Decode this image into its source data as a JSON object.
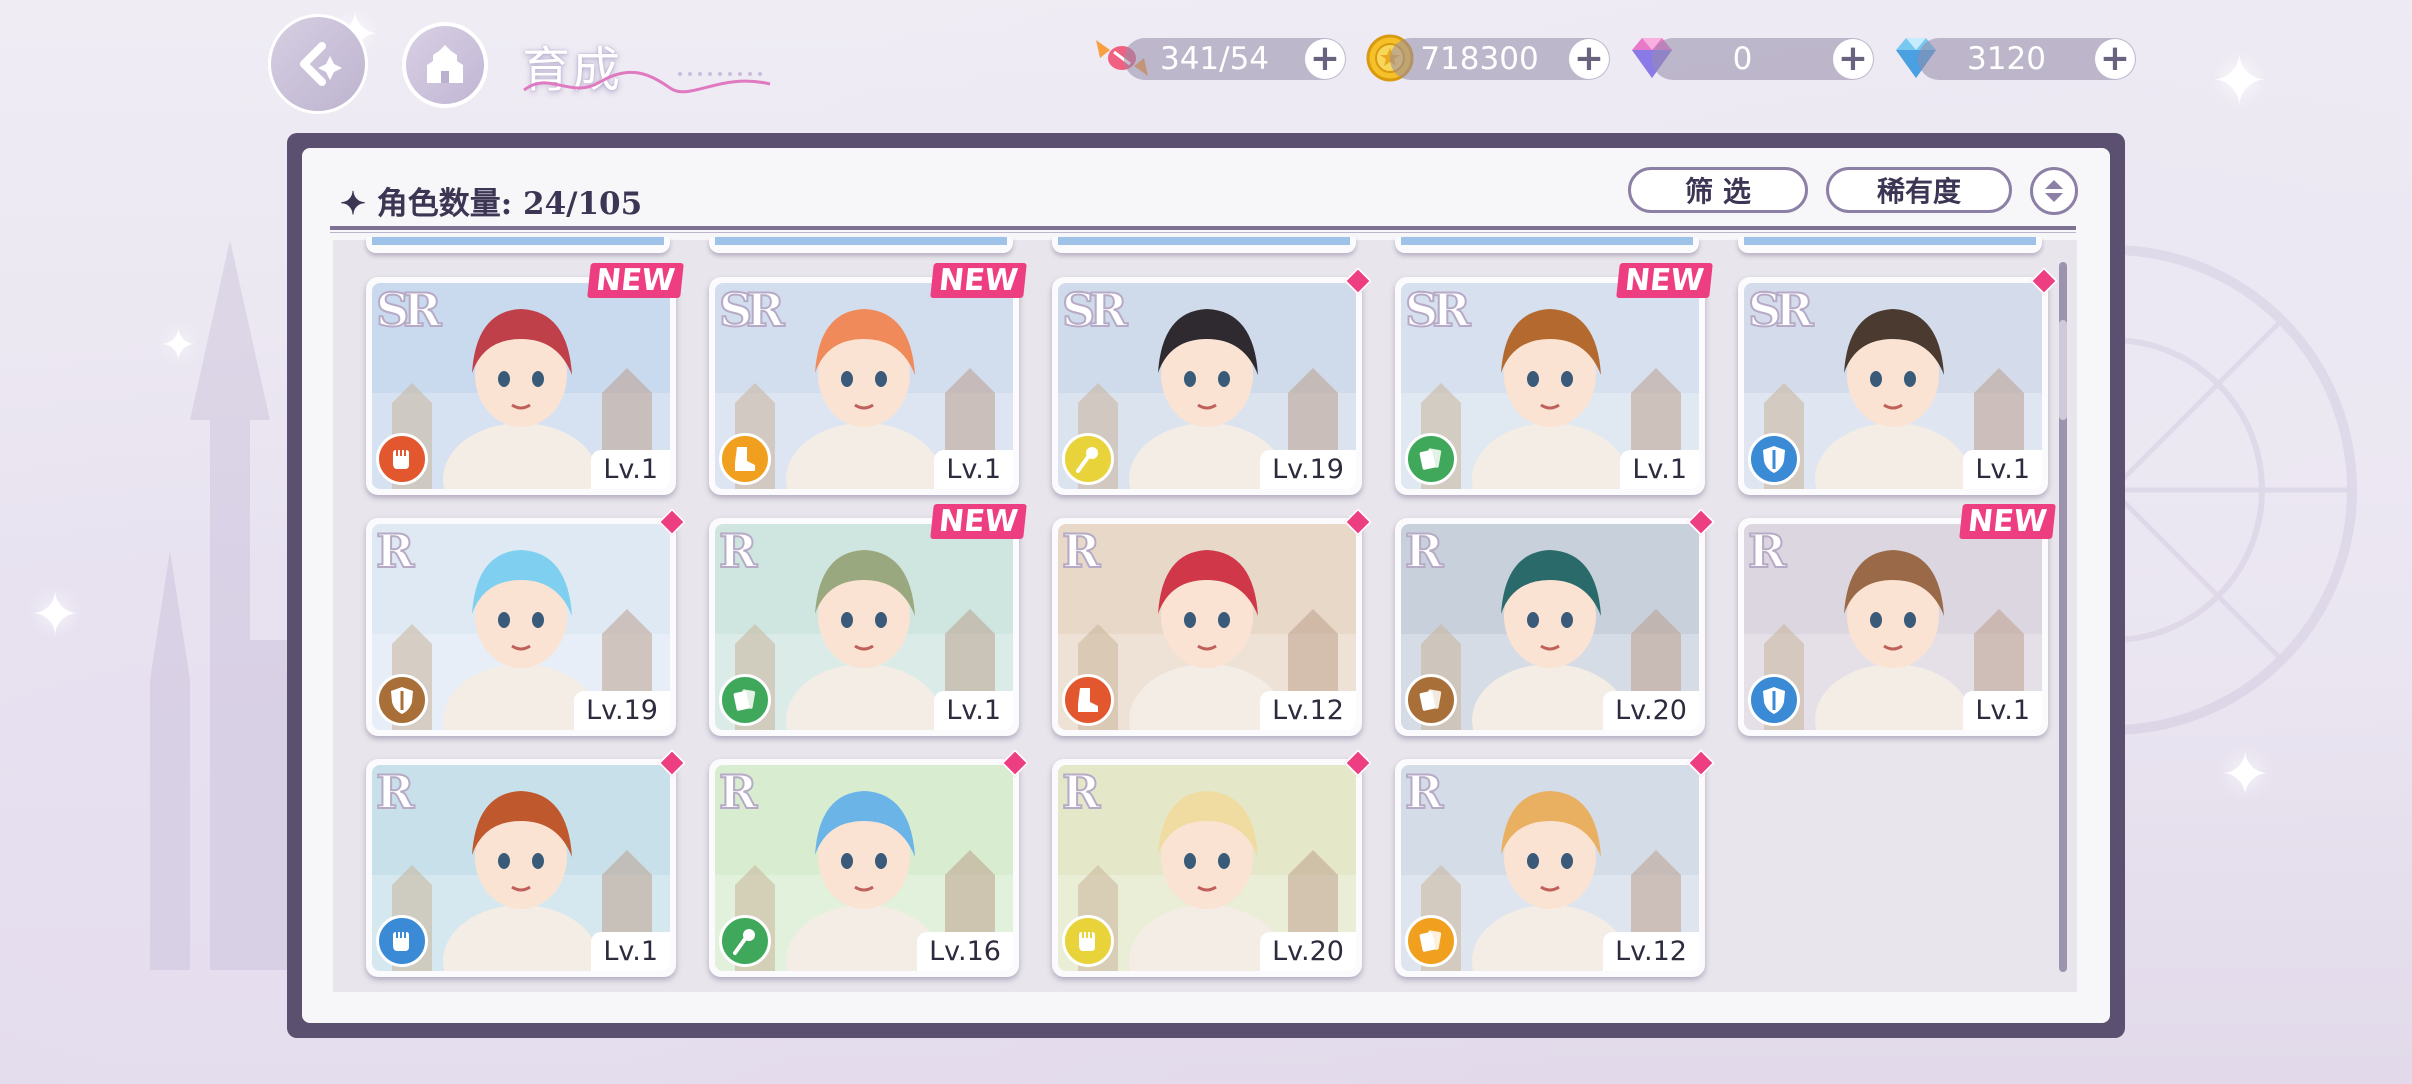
{
  "header": {
    "title": "育成"
  },
  "resources": [
    {
      "name": "candy",
      "value": "341/54"
    },
    {
      "name": "coin",
      "value": "718300"
    },
    {
      "name": "rainbow-gem",
      "value": "0"
    },
    {
      "name": "diamond",
      "value": "3120"
    }
  ],
  "panel": {
    "count_label": "角色数量: 24/105",
    "filter_label": "筛 选",
    "sort_label": "稀有度"
  },
  "colors": {
    "accent_pink": "#ee3e82",
    "panel_frame": "#5b5070",
    "role_red": "#e2572e",
    "role_orange": "#f0a01e",
    "role_yellow": "#e8d43a",
    "role_green": "#3fa85a",
    "role_blue": "#3a8ad6",
    "role_brown": "#a87038"
  },
  "cards": [
    {
      "rarity": "SR",
      "level": "Lv.1",
      "badge": "NEW",
      "role": "fist-icon",
      "role_color": "#e2572e",
      "bg": "#c9d9ee",
      "hair": "#c0404a"
    },
    {
      "rarity": "SR",
      "level": "Lv.1",
      "badge": "NEW",
      "role": "boot-icon",
      "role_color": "#f0a01e",
      "bg": "#d2ddee",
      "hair": "#f08a5a"
    },
    {
      "rarity": "SR",
      "level": "Lv.19",
      "badge": "diamond",
      "role": "staff-icon",
      "role_color": "#e8d43a",
      "bg": "#cfdaea",
      "hair": "#2e2a30"
    },
    {
      "rarity": "SR",
      "level": "Lv.1",
      "badge": "NEW",
      "role": "cards-icon",
      "role_color": "#3fa85a",
      "bg": "#d6e0ee",
      "hair": "#b46a2e"
    },
    {
      "rarity": "SR",
      "level": "Lv.1",
      "badge": "diamond",
      "role": "shield-icon",
      "role_color": "#3a8ad6",
      "bg": "#d4dcec",
      "hair": "#4a3a30"
    },
    {
      "rarity": "R",
      "level": "Lv.19",
      "badge": "diamond",
      "role": "shield-icon",
      "role_color": "#a87038",
      "bg": "#dfe9f4",
      "hair": "#7fd0f0"
    },
    {
      "rarity": "R",
      "level": "Lv.1",
      "badge": "NEW",
      "role": "cards-icon",
      "role_color": "#3fa85a",
      "bg": "#cfe6e0",
      "hair": "#9aa880"
    },
    {
      "rarity": "R",
      "level": "Lv.12",
      "badge": "diamond",
      "role": "boot-icon",
      "role_color": "#e2572e",
      "bg": "#e8d8c8",
      "hair": "#d0384a"
    },
    {
      "rarity": "R",
      "level": "Lv.20",
      "badge": "diamond",
      "role": "cards-icon",
      "role_color": "#a87038",
      "bg": "#c8d0dc",
      "hair": "#2a6a6a"
    },
    {
      "rarity": "R",
      "level": "Lv.1",
      "badge": "NEW",
      "role": "shield-icon",
      "role_color": "#3a8ad6",
      "bg": "#dcd6e0",
      "hair": "#9a6a48"
    },
    {
      "rarity": "R",
      "level": "Lv.1",
      "badge": "diamond",
      "role": "fist-icon",
      "role_color": "#3a8ad6",
      "bg": "#c8e0ea",
      "hair": "#c0582e"
    },
    {
      "rarity": "R",
      "level": "Lv.16",
      "badge": "diamond",
      "role": "staff-icon",
      "role_color": "#3fa85a",
      "bg": "#d8ecd0",
      "hair": "#6ab4e8"
    },
    {
      "rarity": "R",
      "level": "Lv.20",
      "badge": "diamond",
      "role": "fist-icon",
      "role_color": "#e8d43a",
      "bg": "#e4e8c8",
      "hair": "#f0dca0"
    },
    {
      "rarity": "R",
      "level": "Lv.12",
      "badge": "diamond",
      "role": "cards-icon",
      "role_color": "#f0a01e",
      "bg": "#d4dce8",
      "hair": "#e8b060"
    }
  ]
}
